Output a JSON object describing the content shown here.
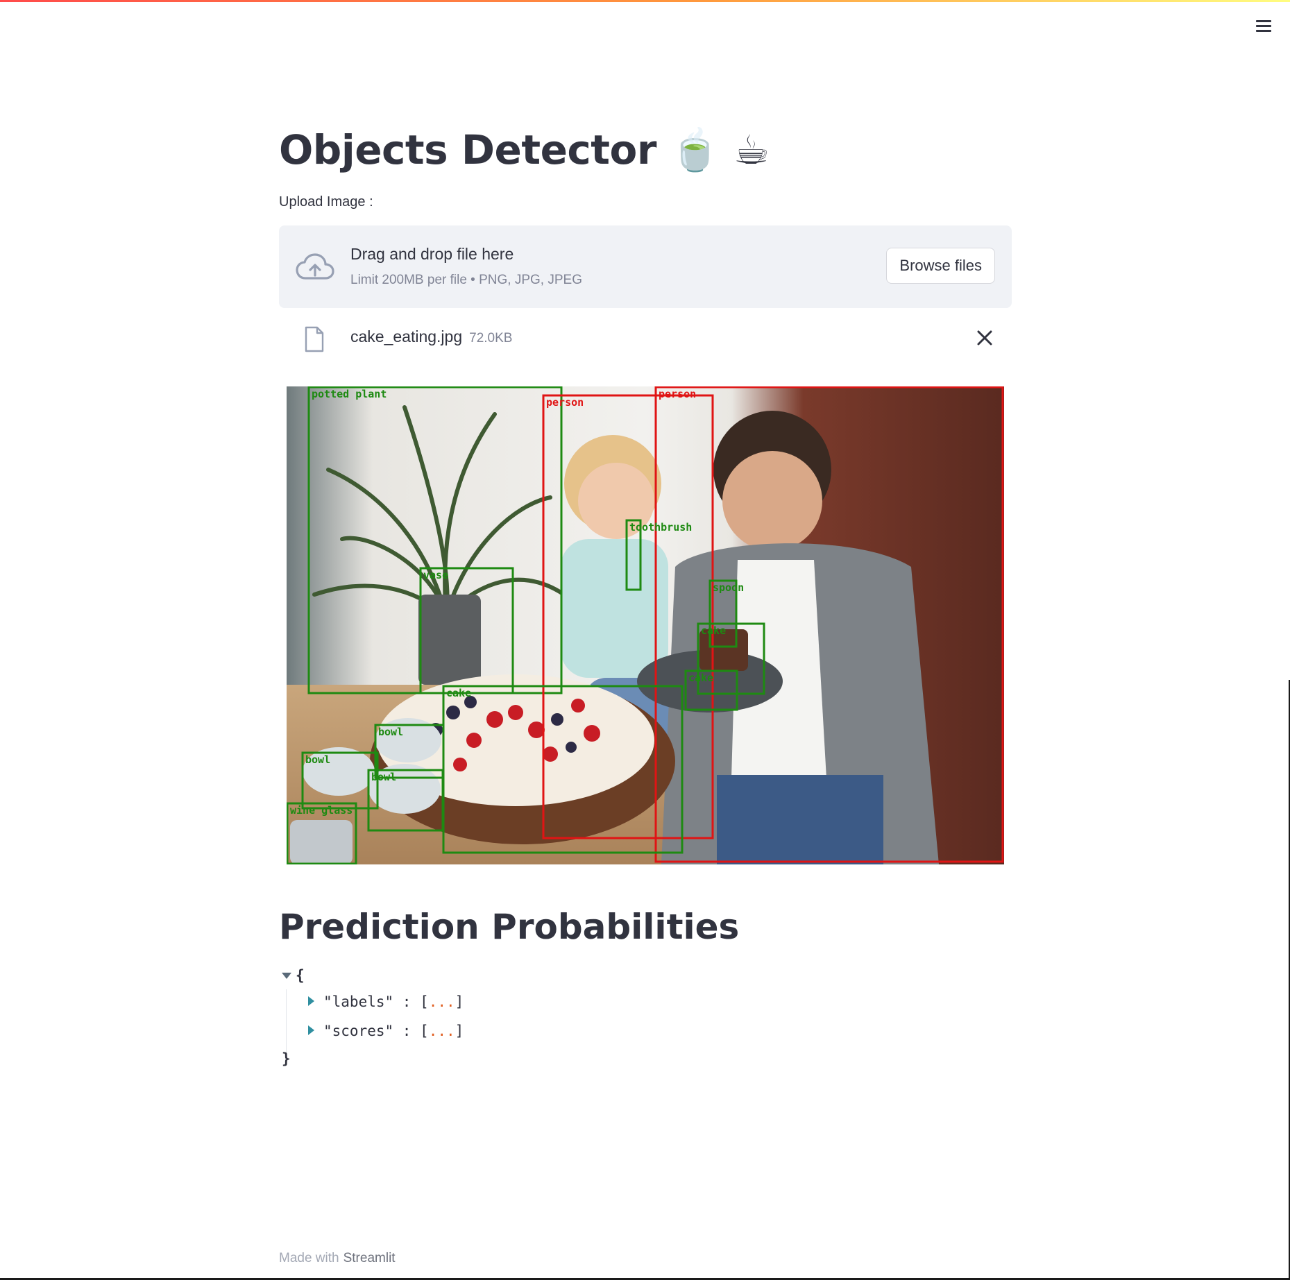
{
  "header": {
    "menu_icon": "hamburger-menu-icon"
  },
  "page": {
    "title": "Objects Detector 🍵 ☕"
  },
  "uploader": {
    "label": "Upload Image :",
    "drop_title": "Drag and drop file here",
    "limit_text": "Limit 200MB per file • PNG, JPG, JPEG",
    "browse_label": "Browse files",
    "upload_icon": "cloud-upload-icon"
  },
  "uploaded_file": {
    "name": "cake_eating.jpg",
    "size": "72.0KB",
    "file_icon": "file-icon",
    "remove_icon": "close-icon"
  },
  "detection_image": {
    "detections": [
      {
        "label": "potted plant",
        "color": "#1e8a12"
      },
      {
        "label": "person",
        "color": "#e01414"
      },
      {
        "label": "person",
        "color": "#e01414"
      },
      {
        "label": "toothbrush",
        "color": "#1e8a12"
      },
      {
        "label": "vase",
        "color": "#1e8a12"
      },
      {
        "label": "spoon",
        "color": "#1e8a12"
      },
      {
        "label": "cake",
        "color": "#1e8a12"
      },
      {
        "label": "cake",
        "color": "#1e8a12"
      },
      {
        "label": "cake",
        "color": "#1e8a12"
      },
      {
        "label": "bowl",
        "color": "#1e8a12"
      },
      {
        "label": "bowl",
        "color": "#1e8a12"
      },
      {
        "label": "bowl",
        "color": "#1e8a12"
      },
      {
        "label": "wine glass",
        "color": "#1e8a12"
      }
    ]
  },
  "predictions": {
    "heading": "Prediction Probabilities",
    "open_brace": "{",
    "close_brace": "}",
    "keys": [
      {
        "key": "\"labels\"",
        "summary": "..."
      },
      {
        "key": "\"scores\"",
        "summary": "..."
      }
    ]
  },
  "footer": {
    "made_with": "Made with",
    "brand": "Streamlit"
  }
}
